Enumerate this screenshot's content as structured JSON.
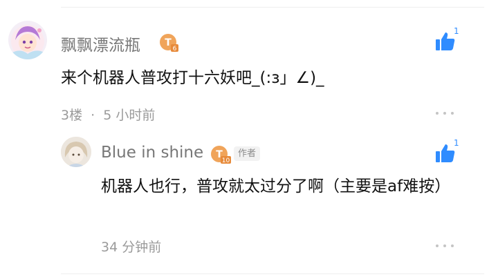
{
  "comment": {
    "username": "飘飘漂流瓶",
    "content": "来个机器人普攻打十六妖吧_(:з」∠)_",
    "floor": "3楼",
    "separator": "·",
    "time": "5 小时前",
    "like_count": "1",
    "badge_level": "6"
  },
  "reply": {
    "username": "Blue in shine",
    "author_tag": "作者",
    "content": "机器人也行，普攻就太过分了啊（主要是af难按）",
    "time": "34 分钟前",
    "like_count": "1",
    "badge_level": "10"
  },
  "colors": {
    "accent": "#2f8cff",
    "badge": "#f0a45a",
    "meta": "#9a9a9a"
  },
  "icons": [
    "thumbs-up-icon",
    "more-icon",
    "level-badge-icon"
  ]
}
